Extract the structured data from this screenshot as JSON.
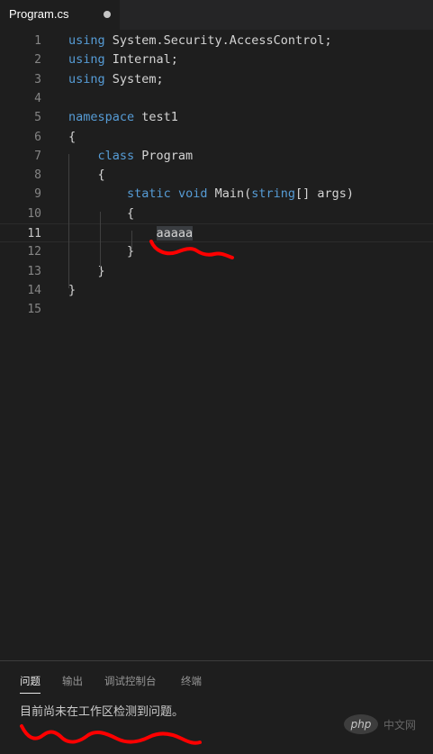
{
  "tab": {
    "title": "Program.cs",
    "dirty_indicator": "dot-icon"
  },
  "editor": {
    "current_line": 11,
    "lines": [
      {
        "num": "1",
        "tokens": [
          {
            "kw": true,
            "t": "using"
          },
          {
            "t": " System.Security.AccessControl;"
          }
        ]
      },
      {
        "num": "2",
        "tokens": [
          {
            "kw": true,
            "t": "using"
          },
          {
            "t": " Internal;"
          }
        ]
      },
      {
        "num": "3",
        "tokens": [
          {
            "kw": true,
            "t": "using"
          },
          {
            "t": " System;"
          }
        ]
      },
      {
        "num": "4",
        "tokens": []
      },
      {
        "num": "5",
        "tokens": [
          {
            "kw": true,
            "t": "namespace"
          },
          {
            "t": " test1"
          }
        ]
      },
      {
        "num": "6",
        "tokens": [
          {
            "t": "{"
          }
        ]
      },
      {
        "num": "7",
        "tokens": [
          {
            "t": "    "
          },
          {
            "kw": true,
            "t": "class"
          },
          {
            "t": " Program"
          }
        ]
      },
      {
        "num": "8",
        "tokens": [
          {
            "t": "    {"
          }
        ]
      },
      {
        "num": "9",
        "tokens": [
          {
            "t": "        "
          },
          {
            "kw": true,
            "t": "static"
          },
          {
            "t": " "
          },
          {
            "kw": true,
            "t": "void"
          },
          {
            "t": " Main("
          },
          {
            "kw": true,
            "t": "string"
          },
          {
            "t": "[] args)"
          }
        ]
      },
      {
        "num": "10",
        "tokens": [
          {
            "t": "        {"
          }
        ]
      },
      {
        "num": "11",
        "tokens": [
          {
            "t": "            "
          },
          {
            "hl": true,
            "t": "aaaaa"
          }
        ]
      },
      {
        "num": "12",
        "tokens": [
          {
            "t": "        }"
          }
        ]
      },
      {
        "num": "13",
        "tokens": [
          {
            "t": "    }"
          }
        ]
      },
      {
        "num": "14",
        "tokens": [
          {
            "t": "}"
          }
        ]
      },
      {
        "num": "15",
        "tokens": []
      }
    ]
  },
  "panel": {
    "tabs": [
      {
        "label": "问题",
        "active": true
      },
      {
        "label": "输出",
        "active": false
      },
      {
        "label": "调试控制台",
        "active": false
      },
      {
        "label": "终端",
        "active": false
      }
    ],
    "message": "目前尚未在工作区检测到问题。"
  },
  "watermark": {
    "logo": "php",
    "text": "中文网"
  },
  "colors": {
    "background": "#1e1e1e",
    "keyword": "#569cd6",
    "annotation": "#ff0000"
  }
}
